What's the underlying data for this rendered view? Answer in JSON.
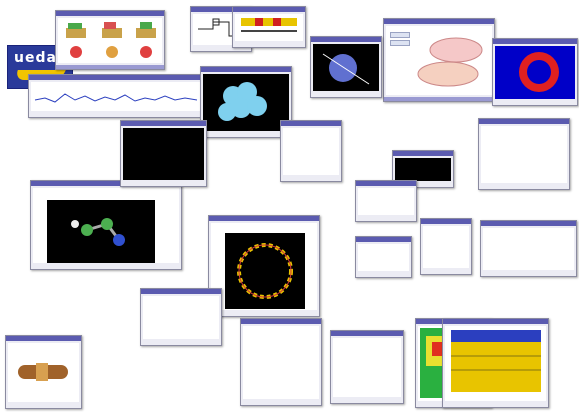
{
  "logo": {
    "text": "ueda",
    "icon": "ueda-logo-icon"
  },
  "colors": {
    "window_bar": "#5b5bb0",
    "window_footer": "#9a9ad2",
    "plot_blue": "#2b3fbf",
    "plot_red": "#d23a3a",
    "plot_green": "#2a9a2a",
    "viz_cyan": "#7fd0ee",
    "field_blue": "#0000c8",
    "field_red": "#e02020",
    "gold": "#e8c400"
  },
  "windows": [
    {
      "id": "w-devices-3d",
      "icon": "device-render-icon"
    },
    {
      "id": "w-circuit",
      "icon": "circuit-icon"
    },
    {
      "id": "w-transistor-bar",
      "icon": "transistor-bar-icon"
    },
    {
      "id": "w-mesh-surface",
      "icon": "mesh-surface-icon"
    },
    {
      "id": "w-field-map",
      "icon": "heatmap-icon"
    },
    {
      "id": "w-wave-plot",
      "icon": "line-plot-icon"
    },
    {
      "id": "w-spheres",
      "icon": "molecule-cluster-icon"
    },
    {
      "id": "w-molecule",
      "icon": "molecule-icon"
    },
    {
      "id": "w-ring",
      "icon": "nanotube-ring-icon"
    },
    {
      "id": "w-cylinder",
      "icon": "nanowire-device-icon"
    },
    {
      "id": "w-contour",
      "icon": "contour-map-icon"
    },
    {
      "id": "w-band",
      "icon": "band-structure-icon"
    }
  ]
}
